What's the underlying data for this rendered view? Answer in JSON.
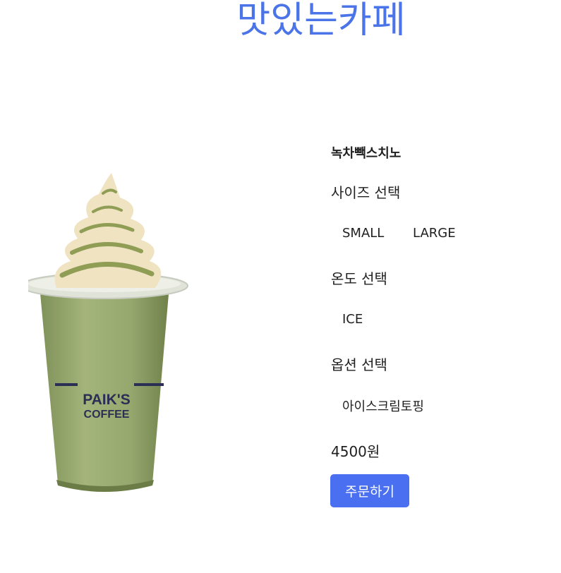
{
  "header": {
    "title": "맛있는카페"
  },
  "product": {
    "name": "녹차빽스치노",
    "image_brand": [
      "PAIK'S",
      "COFFEE"
    ],
    "price": "4500원"
  },
  "size": {
    "label": "사이즈 선택",
    "options": [
      "SMALL",
      "LARGE"
    ]
  },
  "temperature": {
    "label": "온도 선택",
    "options": [
      "ICE"
    ]
  },
  "extras": {
    "label": "옵션 선택",
    "options": [
      "아이스크림토핑"
    ]
  },
  "actions": {
    "order_label": "주문하기"
  },
  "colors": {
    "title": "#4a74e8",
    "button": "#4a6ff0",
    "drink": "#96a86e",
    "cream": "#f0e6c8"
  }
}
